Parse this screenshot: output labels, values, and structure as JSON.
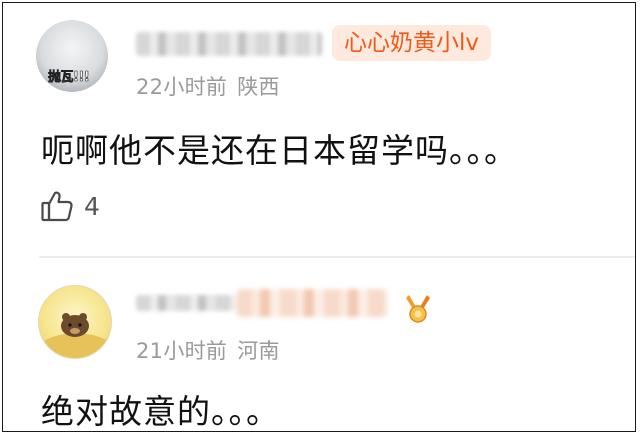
{
  "comments": [
    {
      "badge": "心心奶黄小lv",
      "avatar_sticker": "抛瓦!!!",
      "time": "22小时前",
      "location": "陕西",
      "content": "呃啊他不是还在日本留学吗。。。",
      "like_icon": "thumbs-up-icon",
      "likes": "4"
    },
    {
      "time": "21小时前",
      "location": "河南",
      "content": "绝对故意的。。。",
      "medal_icon": "medal-icon"
    }
  ]
}
